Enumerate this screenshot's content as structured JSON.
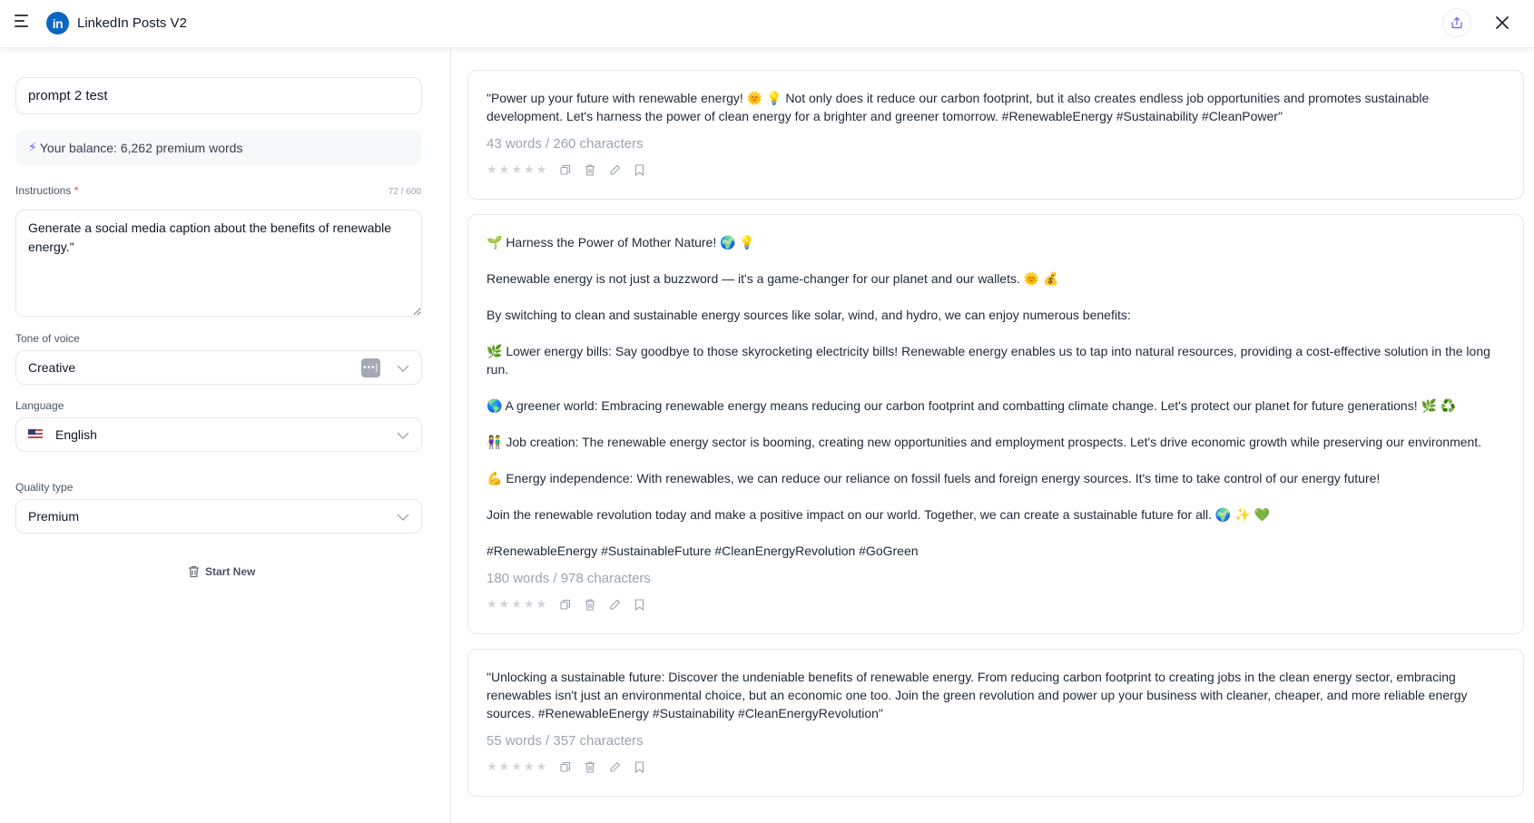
{
  "header": {
    "app_title": "LinkedIn Posts V2",
    "logo_text": "in",
    "icons": {
      "menu": "hamburger-menu-icon",
      "share": "share-upload-icon",
      "close": "close-icon"
    }
  },
  "sidebar": {
    "title_input_value": "prompt 2 test",
    "balance_icon": "⚡",
    "balance_text": "Your balance: 6,262 premium words",
    "instructions": {
      "label": "Instructions",
      "required_mark": "*",
      "counter": "72 / 600",
      "value": "Generate a social media caption about the benefits of renewable energy.\""
    },
    "tone": {
      "label": "Tone of voice",
      "value": "Creative",
      "badge": "•••|"
    },
    "language": {
      "label": "Language",
      "value": "English",
      "flag": "us-flag-icon"
    },
    "quality": {
      "label": "Quality type",
      "value": "Premium"
    },
    "start_new_label": "Start New"
  },
  "results": [
    {
      "paragraphs": [
        "\"Power up your future with renewable energy! 🌞 💡 Not only does it reduce our carbon footprint, but it also creates endless job opportunities and promotes sustainable development. Let's harness the power of clean energy for a brighter and greener tomorrow. #RenewableEnergy #Sustainability #CleanPower\""
      ],
      "stats": "43 words / 260 characters",
      "rating": 0
    },
    {
      "paragraphs": [
        "🌱 Harness the Power of Mother Nature! 🌍 💡",
        "Renewable energy is not just a buzzword — it's a game-changer for our planet and our wallets. 🌞 💰",
        "By switching to clean and sustainable energy sources like solar, wind, and hydro, we can enjoy numerous benefits:",
        "🌿 Lower energy bills: Say goodbye to those skyrocketing electricity bills! Renewable energy enables us to tap into natural resources, providing a cost-effective solution in the long run.",
        "🌎 A greener world: Embracing renewable energy means reducing our carbon footprint and combatting climate change. Let's protect our planet for future generations! 🌿 ♻️",
        "👫 Job creation: The renewable energy sector is booming, creating new opportunities and employment prospects. Let's drive economic growth while preserving our environment.",
        "💪 Energy independence: With renewables, we can reduce our reliance on fossil fuels and foreign energy sources. It's time to take control of our energy future!",
        "Join the renewable revolution today and make a positive impact on our world. Together, we can create a sustainable future for all. 🌍 ✨ 💚",
        "#RenewableEnergy #SustainableFuture #CleanEnergyRevolution #GoGreen"
      ],
      "stats": "180 words / 978 characters",
      "rating": 0
    },
    {
      "paragraphs": [
        "\"Unlocking a sustainable future: Discover the undeniable benefits of renewable energy. From reducing carbon footprint to creating jobs in the clean energy sector, embracing renewables isn't just an environmental choice, but an economic one too. Join the green revolution and power up your business with cleaner, cheaper, and more reliable energy sources. #RenewableEnergy #Sustainability #CleanEnergyRevolution\""
      ],
      "stats": "55 words / 357 characters",
      "rating": 0
    }
  ],
  "card_actions": [
    "copy-icon",
    "trash-icon",
    "pencil-icon",
    "bookmark-icon"
  ],
  "colors": {
    "accent": "#6d5ef5",
    "linkedin": "#0a66c2",
    "required": "#ef4444",
    "muted": "#9ca3af"
  }
}
